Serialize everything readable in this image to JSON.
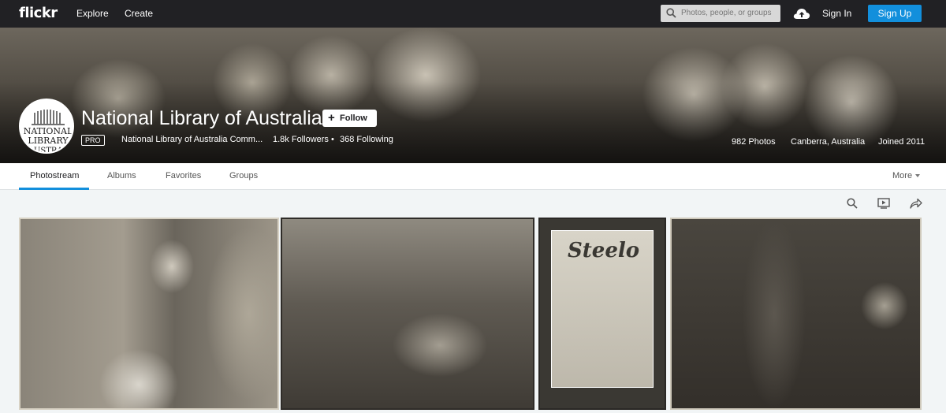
{
  "nav": {
    "logo": "flickr",
    "explore": "Explore",
    "create": "Create",
    "search_placeholder": "Photos, people, or groups",
    "sign_in": "Sign In",
    "sign_up": "Sign Up"
  },
  "profile": {
    "name": "National Library of Australia",
    "follow_label": "Follow",
    "pro_badge": "PRO",
    "subtitle": "National Library of Australia Comm...",
    "followers": "1.8k Followers",
    "separator": "•",
    "following": "368 Following",
    "photos": "982 Photos",
    "location": "Canberra, Australia",
    "joined": "Joined 2011",
    "avatar_text": [
      "NATIONAL",
      "LIBRARY",
      "AUSTRAL"
    ]
  },
  "tabs": [
    {
      "label": "Photostream",
      "active": true
    },
    {
      "label": "Albums",
      "active": false
    },
    {
      "label": "Favorites",
      "active": false
    },
    {
      "label": "Groups",
      "active": false
    }
  ],
  "more_label": "More",
  "poster": {
    "title": "Steelo"
  },
  "colors": {
    "topbar": "#212124",
    "accent": "#128fdc",
    "tab_underline": "#128fdc"
  },
  "icons": [
    "search-icon",
    "cloud-upload-icon",
    "slideshow-icon",
    "share-icon",
    "plus-icon",
    "caret-down-icon"
  ]
}
